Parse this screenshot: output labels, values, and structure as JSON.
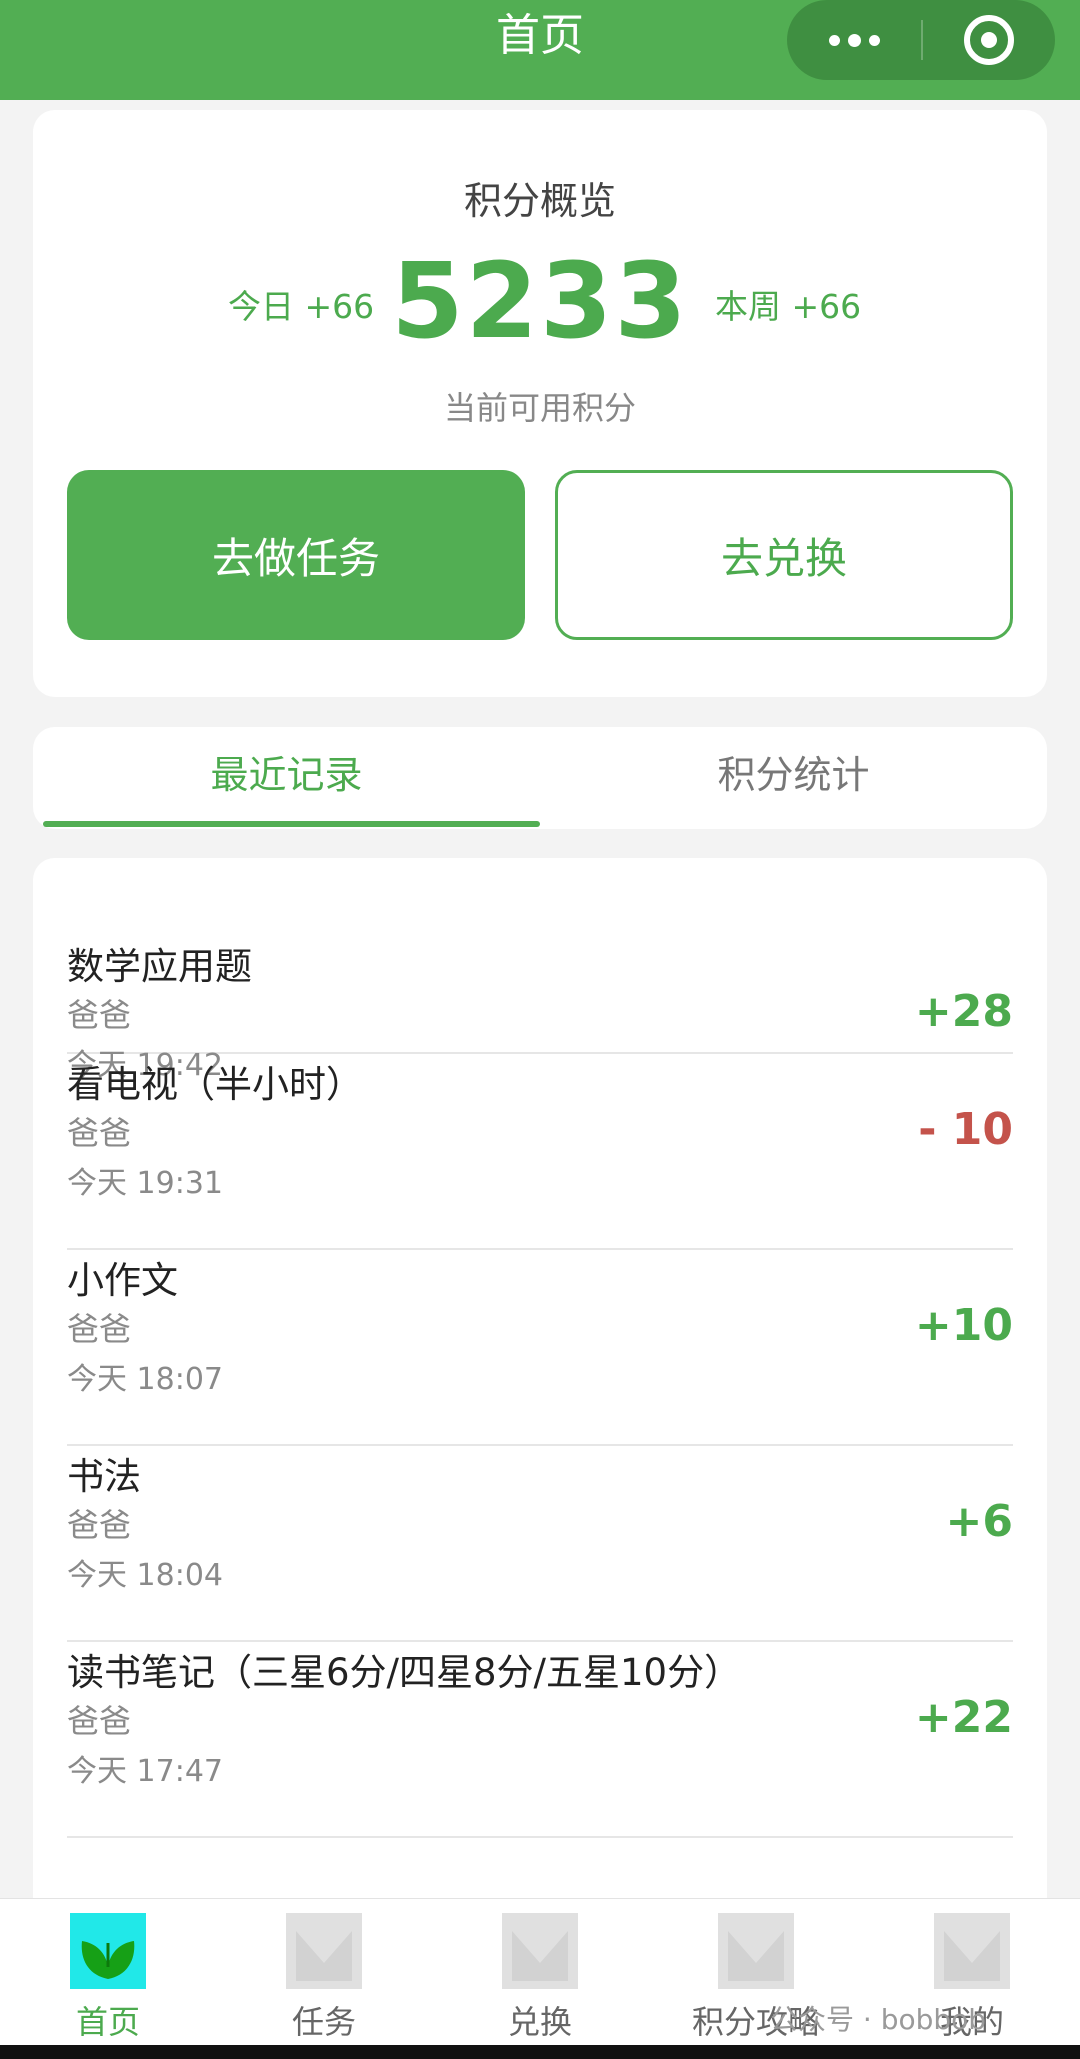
{
  "header": {
    "title": "首页"
  },
  "overview": {
    "title": "积分概览",
    "today": "今日 +66",
    "total": "5233",
    "week": "本周 +66",
    "caption": "当前可用积分",
    "task_button": "去做任务",
    "redeem_button": "去兑换"
  },
  "tabs": {
    "recent": "最近记录",
    "stats": "积分统计",
    "active": "recent"
  },
  "records": [
    {
      "name": "数学应用题",
      "by": "爸爸",
      "time": "今天 19:42",
      "points": "+28"
    },
    {
      "name": "看电视（半小时）",
      "by": "爸爸",
      "time": "今天 19:31",
      "points": "- 10"
    },
    {
      "name": "小作文",
      "by": "爸爸",
      "time": "今天 18:07",
      "points": "+10"
    },
    {
      "name": "书法",
      "by": "爸爸",
      "time": "今天 18:04",
      "points": "+6"
    },
    {
      "name": "读书笔记（三星6分/四星8分/五星10分）",
      "by": "爸爸",
      "time": "今天 17:47",
      "points": "+22"
    }
  ],
  "nav": [
    {
      "label": "首页",
      "icon": "home-leaf-icon",
      "active": true
    },
    {
      "label": "任务",
      "icon": "placeholder-icon",
      "active": false
    },
    {
      "label": "兑换",
      "icon": "placeholder-icon",
      "active": false
    },
    {
      "label": "积分攻略",
      "icon": "placeholder-icon",
      "active": false
    },
    {
      "label": "我的",
      "icon": "placeholder-icon",
      "active": false
    }
  ],
  "watermark": "公众号 · bobbob",
  "colors": {
    "brand_green": "#52ae53",
    "positive": "#4caa4e",
    "negative": "#c4534b",
    "active_icon_bg": "#21e8e8"
  }
}
